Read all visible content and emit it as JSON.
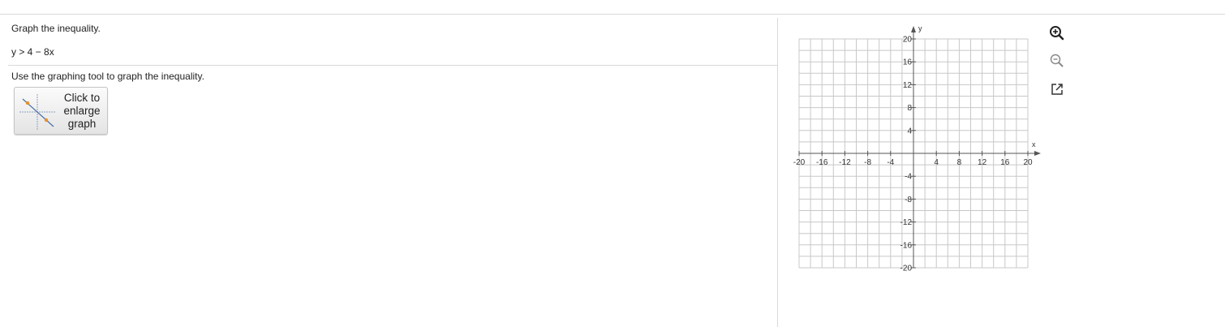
{
  "question": {
    "instruction": "Graph the inequality.",
    "inequality": "y > 4 − 8x",
    "tool_instruction": "Use the graphing tool to graph the inequality."
  },
  "enlarge_button": {
    "label": "Click to\nenlarge\ngraph",
    "thumb_icon": "graph-thumbnail-icon"
  },
  "graph": {
    "x_axis_label": "x",
    "y_axis_label": "y",
    "x_range": [
      -20,
      20
    ],
    "y_range": [
      -20,
      20
    ],
    "minor_grid_step": 2,
    "tick_step": 4,
    "x_tick_labels": [
      "-20",
      "-16",
      "-12",
      "-8",
      "-4",
      "4",
      "8",
      "12",
      "16",
      "20"
    ],
    "y_tick_labels": [
      "20",
      "16",
      "12",
      "8",
      "4",
      "-4",
      "-8",
      "-12",
      "-16",
      "-20"
    ]
  },
  "tools": [
    {
      "name": "zoom-in-icon"
    },
    {
      "name": "zoom-out-icon"
    },
    {
      "name": "popout-icon"
    }
  ],
  "colors": {
    "grid": "#c8c8c8",
    "axis": "#555555",
    "icon": "#333333",
    "icon_disabled": "#9a9a9a",
    "thumb_point": "#e8912d",
    "thumb_line": "#4a6fa5"
  }
}
